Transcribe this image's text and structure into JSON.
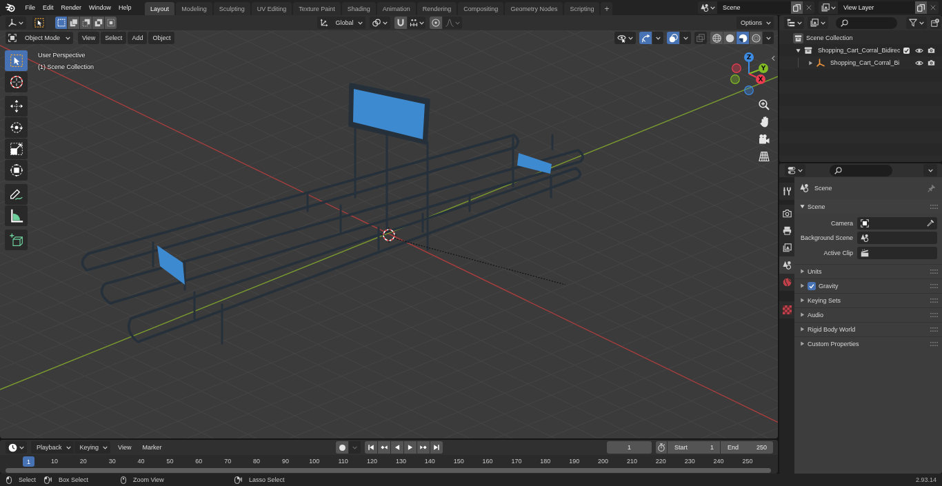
{
  "top_bar": {
    "menus": [
      "File",
      "Edit",
      "Render",
      "Window",
      "Help"
    ],
    "workspaces": [
      {
        "label": "Layout",
        "selected": true
      },
      {
        "label": "Modeling",
        "selected": false
      },
      {
        "label": "Sculpting",
        "selected": false
      },
      {
        "label": "UV Editing",
        "selected": false
      },
      {
        "label": "Texture Paint",
        "selected": false
      },
      {
        "label": "Shading",
        "selected": false
      },
      {
        "label": "Animation",
        "selected": false
      },
      {
        "label": "Rendering",
        "selected": false
      },
      {
        "label": "Compositing",
        "selected": false
      },
      {
        "label": "Geometry Nodes",
        "selected": false
      },
      {
        "label": "Scripting",
        "selected": false
      }
    ],
    "add_workspace": "+",
    "scene": "Scene",
    "view_layer": "View Layer"
  },
  "tool_header": {
    "selection_modes": [
      {
        "kind": "set",
        "selected": true
      },
      {
        "kind": "extend",
        "selected": false
      },
      {
        "kind": "subtract",
        "selected": false
      },
      {
        "kind": "difference",
        "selected": false
      },
      {
        "kind": "intersect",
        "selected": false
      }
    ],
    "orientation": "Global",
    "snap_on": false,
    "proportional_on": false,
    "options": "Options"
  },
  "viewport_header": {
    "mode": "Object Mode",
    "menus": [
      "View",
      "Select",
      "Add",
      "Object"
    ],
    "gizmos_on": true,
    "overlays_on": true,
    "xray_on": false,
    "shading": [
      {
        "kind": "wireframe",
        "selected": false
      },
      {
        "kind": "solid",
        "selected": false
      },
      {
        "kind": "material",
        "selected": true
      },
      {
        "kind": "rendered",
        "selected": false
      }
    ]
  },
  "viewport": {
    "info": [
      "User Perspective",
      "(1) Scene Collection"
    ],
    "tools": [
      {
        "kind": "select_box",
        "selected": true
      },
      {
        "kind": "cursor",
        "selected": false
      },
      {
        "kind": "move",
        "selected": false
      },
      {
        "kind": "rotate",
        "selected": false
      },
      {
        "kind": "scale",
        "selected": false
      },
      {
        "kind": "transform",
        "selected": false
      },
      {
        "kind": "annotate",
        "selected": false
      },
      {
        "kind": "measure",
        "selected": false
      },
      {
        "kind": "add_cube",
        "selected": false
      }
    ],
    "gizmo_axes": [
      {
        "label": "Z",
        "color": "#3d8be3"
      },
      {
        "label": "Y",
        "color": "#82bb24"
      },
      {
        "label": "X",
        "color": "#ef3a50"
      }
    ]
  },
  "outliner": {
    "root": "Scene Collection",
    "items": [
      {
        "label": "Shopping_Cart_Corral_Bidirec",
        "kind": "collection",
        "expanded": true,
        "checked": true,
        "children": [
          {
            "label": "Shopping_Cart_Corral_Bi",
            "kind": "empty",
            "expanded": false
          }
        ]
      }
    ]
  },
  "properties": {
    "tabs": [
      {
        "kind": "tool",
        "selected": false
      },
      {
        "kind": "render",
        "selected": false
      },
      {
        "kind": "output",
        "selected": false
      },
      {
        "kind": "view_layer",
        "selected": false
      },
      {
        "kind": "scene",
        "selected": true
      },
      {
        "kind": "world",
        "selected": false
      },
      {
        "kind": "texture",
        "selected": false
      }
    ],
    "context": "Scene",
    "panel": {
      "title": "Scene",
      "expanded": true,
      "fields": [
        {
          "label": "Camera",
          "kind": "object"
        },
        {
          "label": "Background Scene",
          "kind": "scene"
        },
        {
          "label": "Active Clip",
          "kind": "clip"
        }
      ]
    },
    "subpanels": [
      {
        "title": "Units",
        "expanded": false
      },
      {
        "title": "Gravity",
        "expanded": false,
        "checked": true
      },
      {
        "title": "Keying Sets",
        "expanded": false
      },
      {
        "title": "Audio",
        "expanded": false
      },
      {
        "title": "Rigid Body World",
        "expanded": false
      },
      {
        "title": "Custom Properties",
        "expanded": false
      }
    ]
  },
  "timeline": {
    "menus": [
      {
        "label": "Playback",
        "kind": "dropdown"
      },
      {
        "label": "Keying",
        "kind": "dropdown"
      },
      {
        "label": "View",
        "kind": "menu"
      },
      {
        "label": "Marker",
        "kind": "menu"
      }
    ],
    "auto_key": false,
    "current_frame": "1",
    "start_label": "Start",
    "start": "1",
    "end_label": "End",
    "end": "250",
    "marker": "1",
    "ruler_labels": [
      "10",
      "20",
      "30",
      "40",
      "50",
      "60",
      "70",
      "80",
      "90",
      "100",
      "110",
      "120",
      "130",
      "140",
      "150",
      "160",
      "170",
      "180",
      "190",
      "200",
      "210",
      "220",
      "230",
      "240",
      "250"
    ]
  },
  "status_bar": {
    "hints": [
      {
        "kind": "left_click",
        "label": "Select"
      },
      {
        "kind": "left_drag",
        "label": "Box Select"
      },
      {
        "kind": "middle_click",
        "label": "Zoom View"
      },
      {
        "kind": "right_drag",
        "label": "Lasso Select"
      }
    ],
    "version": "2.93.14"
  }
}
